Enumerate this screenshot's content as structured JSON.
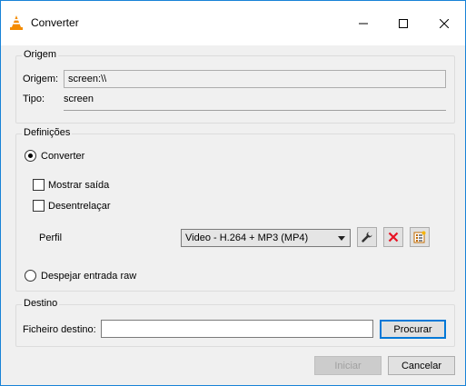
{
  "window": {
    "title": "Converter"
  },
  "source": {
    "group_title": "Origem",
    "origin_label": "Origem:",
    "origin_value": "screen:\\\\",
    "type_label": "Tipo:",
    "type_value": "screen"
  },
  "settings": {
    "group_title": "Definições",
    "convert_label": "Converter",
    "convert_selected": true,
    "show_output_label": "Mostrar saída",
    "show_output_checked": false,
    "deinterlace_label": "Desentrelaçar",
    "deinterlace_checked": false,
    "profile_label": "Perfil",
    "profile_value": "Video - H.264 + MP3 (MP4)",
    "dump_raw_label": "Despejar entrada raw",
    "dump_raw_selected": false
  },
  "destination": {
    "group_title": "Destino",
    "file_label": "Ficheiro destino:",
    "file_value": "",
    "browse_label": "Procurar"
  },
  "footer": {
    "start_label": "Iniciar",
    "cancel_label": "Cancelar"
  },
  "icons": {
    "app": "vlc-cone-icon",
    "edit_profile": "wrench-icon",
    "delete_profile": "red-x-icon",
    "new_profile": "new-profile-icon"
  },
  "colors": {
    "accent": "#0078d7",
    "delete": "#e81123",
    "window_border": "#1883d7"
  }
}
